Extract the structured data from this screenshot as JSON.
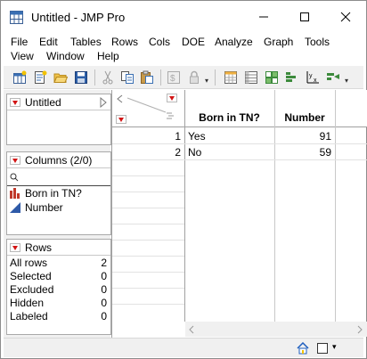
{
  "window": {
    "title": "Untitled - JMP Pro",
    "minimize_icon": "minimize-icon",
    "maximize_icon": "maximize-icon",
    "close_icon": "close-icon"
  },
  "menubar": {
    "items": [
      "File",
      "Edit",
      "Tables",
      "Rows",
      "Cols",
      "DOE",
      "Analyze",
      "Graph",
      "Tools",
      "View",
      "Window",
      "Help"
    ]
  },
  "toolbar": {
    "icons": [
      "new-data-table-icon",
      "new-script-icon",
      "open-icon",
      "save-icon",
      "cut-icon",
      "copy-icon",
      "paste-icon",
      "run-script-icon",
      "lock-icon",
      "data-table-icon",
      "table-list-icon",
      "grid-icon",
      "distribution-icon",
      "fit-y-by-x-icon",
      "fit-model-icon"
    ]
  },
  "table_panel": {
    "title": "Untitled"
  },
  "columns_panel": {
    "title": "Columns (2/0)",
    "search_placeholder": "",
    "columns": [
      {
        "name": "Born in TN?",
        "icon": "nominal-column-icon"
      },
      {
        "name": "Number",
        "icon": "continuous-column-icon"
      }
    ]
  },
  "rows_panel": {
    "title": "Rows",
    "items": [
      {
        "label": "All rows",
        "value": "2"
      },
      {
        "label": "Selected",
        "value": "0"
      },
      {
        "label": "Excluded",
        "value": "0"
      },
      {
        "label": "Hidden",
        "value": "0"
      },
      {
        "label": "Labeled",
        "value": "0"
      }
    ]
  },
  "grid": {
    "headers": [
      "Born in TN?",
      "Number"
    ],
    "rows": [
      {
        "num": "1",
        "born": "Yes",
        "number": "91"
      },
      {
        "num": "2",
        "born": "No",
        "number": "59"
      }
    ]
  },
  "colors": {
    "accent_red": "#d21414",
    "selection_blue": "#1f5fbf"
  }
}
